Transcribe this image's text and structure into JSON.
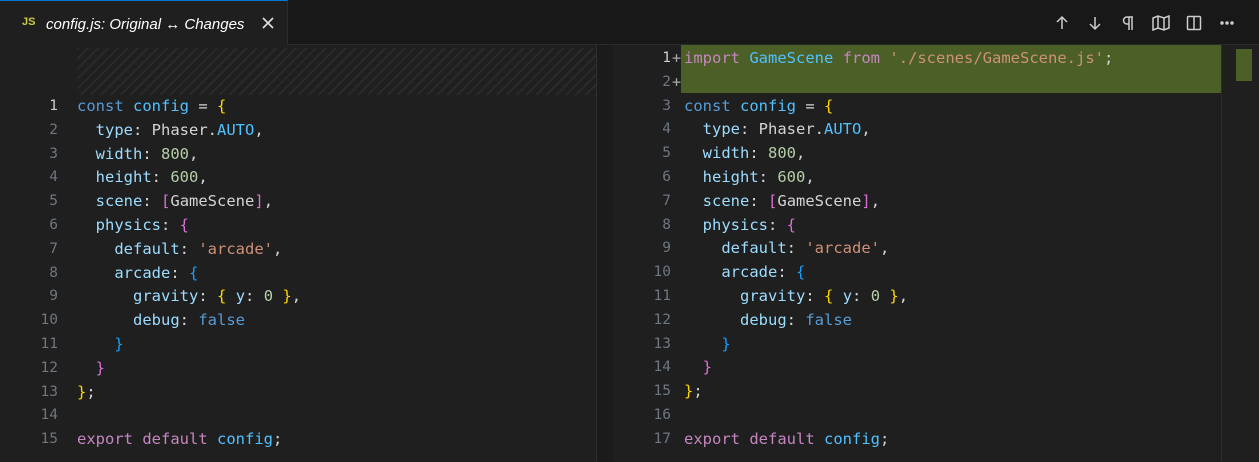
{
  "tab": {
    "icon_text": "JS",
    "title": "config.js: Original ↔ Changes"
  },
  "toolbar": {
    "actions": [
      "arrow-up-icon",
      "arrow-down-icon",
      "pilcrow-icon",
      "map-icon",
      "split-editor-icon",
      "more-icon"
    ]
  },
  "colors": {
    "accent": "#0078d4",
    "added_line": "#4b5f27",
    "keyword": "#569cd6",
    "control_keyword": "#c586c0",
    "string": "#ce9178",
    "number": "#b5cea8",
    "bracket_gold": "#ffd700",
    "bracket_pink": "#da70d6",
    "bracket_blue": "#179fff"
  },
  "left": {
    "line_numbers": [
      "1",
      "2",
      "3",
      "4",
      "5",
      "6",
      "7",
      "8",
      "9",
      "10",
      "11",
      "12",
      "13",
      "14",
      "15"
    ],
    "lines": [
      [
        [
          "kw",
          "const"
        ],
        [
          "plain",
          " "
        ],
        [
          "var",
          "config"
        ],
        [
          "plain",
          " = "
        ],
        [
          "b1",
          "{"
        ]
      ],
      [
        [
          "plain",
          "  "
        ],
        [
          "prop",
          "type"
        ],
        [
          "plain",
          ": Phaser."
        ],
        [
          "const",
          "AUTO"
        ],
        [
          "plain",
          ","
        ]
      ],
      [
        [
          "plain",
          "  "
        ],
        [
          "prop",
          "width"
        ],
        [
          "plain",
          ": "
        ],
        [
          "num",
          "800"
        ],
        [
          "plain",
          ","
        ]
      ],
      [
        [
          "plain",
          "  "
        ],
        [
          "prop",
          "height"
        ],
        [
          "plain",
          ": "
        ],
        [
          "num",
          "600"
        ],
        [
          "plain",
          ","
        ]
      ],
      [
        [
          "plain",
          "  "
        ],
        [
          "prop",
          "scene"
        ],
        [
          "plain",
          ": "
        ],
        [
          "b2",
          "["
        ],
        [
          "plain",
          "GameScene"
        ],
        [
          "b2",
          "]"
        ],
        [
          "plain",
          ","
        ]
      ],
      [
        [
          "plain",
          "  "
        ],
        [
          "prop",
          "physics"
        ],
        [
          "plain",
          ": "
        ],
        [
          "b2",
          "{"
        ]
      ],
      [
        [
          "plain",
          "    "
        ],
        [
          "prop",
          "default"
        ],
        [
          "plain",
          ": "
        ],
        [
          "str",
          "'arcade'"
        ],
        [
          "plain",
          ","
        ]
      ],
      [
        [
          "plain",
          "    "
        ],
        [
          "prop",
          "arcade"
        ],
        [
          "plain",
          ": "
        ],
        [
          "b3",
          "{"
        ]
      ],
      [
        [
          "plain",
          "      "
        ],
        [
          "prop",
          "gravity"
        ],
        [
          "plain",
          ": "
        ],
        [
          "b1",
          "{"
        ],
        [
          "plain",
          " "
        ],
        [
          "prop",
          "y"
        ],
        [
          "plain",
          ": "
        ],
        [
          "num",
          "0"
        ],
        [
          "plain",
          " "
        ],
        [
          "b1",
          "}"
        ],
        [
          "plain",
          ","
        ]
      ],
      [
        [
          "plain",
          "      "
        ],
        [
          "prop",
          "debug"
        ],
        [
          "plain",
          ": "
        ],
        [
          "kw",
          "false"
        ]
      ],
      [
        [
          "plain",
          "    "
        ],
        [
          "b3",
          "}"
        ]
      ],
      [
        [
          "plain",
          "  "
        ],
        [
          "b2",
          "}"
        ]
      ],
      [
        [
          "b1",
          "}"
        ],
        [
          "plain",
          ";"
        ]
      ],
      [],
      [
        [
          "kw2",
          "export"
        ],
        [
          "plain",
          " "
        ],
        [
          "kw2",
          "default"
        ],
        [
          "plain",
          " "
        ],
        [
          "var",
          "config"
        ],
        [
          "plain",
          ";"
        ]
      ]
    ]
  },
  "right": {
    "line_numbers": [
      "1",
      "2",
      "3",
      "4",
      "5",
      "6",
      "7",
      "8",
      "9",
      "10",
      "11",
      "12",
      "13",
      "14",
      "15",
      "16",
      "17"
    ],
    "added_markers": [
      "+",
      "+"
    ],
    "lines": [
      [
        [
          "kw2",
          "import"
        ],
        [
          "plain",
          " "
        ],
        [
          "var",
          "GameScene"
        ],
        [
          "plain",
          " "
        ],
        [
          "kw2",
          "from"
        ],
        [
          "plain",
          " "
        ],
        [
          "str",
          "'./scenes/GameScene.js'"
        ],
        [
          "plain",
          ";"
        ]
      ],
      [],
      [
        [
          "kw",
          "const"
        ],
        [
          "plain",
          " "
        ],
        [
          "var",
          "config"
        ],
        [
          "plain",
          " = "
        ],
        [
          "b1",
          "{"
        ]
      ],
      [
        [
          "plain",
          "  "
        ],
        [
          "prop",
          "type"
        ],
        [
          "plain",
          ": Phaser."
        ],
        [
          "const",
          "AUTO"
        ],
        [
          "plain",
          ","
        ]
      ],
      [
        [
          "plain",
          "  "
        ],
        [
          "prop",
          "width"
        ],
        [
          "plain",
          ": "
        ],
        [
          "num",
          "800"
        ],
        [
          "plain",
          ","
        ]
      ],
      [
        [
          "plain",
          "  "
        ],
        [
          "prop",
          "height"
        ],
        [
          "plain",
          ": "
        ],
        [
          "num",
          "600"
        ],
        [
          "plain",
          ","
        ]
      ],
      [
        [
          "plain",
          "  "
        ],
        [
          "prop",
          "scene"
        ],
        [
          "plain",
          ": "
        ],
        [
          "b2",
          "["
        ],
        [
          "plain",
          "GameScene"
        ],
        [
          "b2",
          "]"
        ],
        [
          "plain",
          ","
        ]
      ],
      [
        [
          "plain",
          "  "
        ],
        [
          "prop",
          "physics"
        ],
        [
          "plain",
          ": "
        ],
        [
          "b2",
          "{"
        ]
      ],
      [
        [
          "plain",
          "    "
        ],
        [
          "prop",
          "default"
        ],
        [
          "plain",
          ": "
        ],
        [
          "str",
          "'arcade'"
        ],
        [
          "plain",
          ","
        ]
      ],
      [
        [
          "plain",
          "    "
        ],
        [
          "prop",
          "arcade"
        ],
        [
          "plain",
          ": "
        ],
        [
          "b3",
          "{"
        ]
      ],
      [
        [
          "plain",
          "      "
        ],
        [
          "prop",
          "gravity"
        ],
        [
          "plain",
          ": "
        ],
        [
          "b1",
          "{"
        ],
        [
          "plain",
          " "
        ],
        [
          "prop",
          "y"
        ],
        [
          "plain",
          ": "
        ],
        [
          "num",
          "0"
        ],
        [
          "plain",
          " "
        ],
        [
          "b1",
          "}"
        ],
        [
          "plain",
          ","
        ]
      ],
      [
        [
          "plain",
          "      "
        ],
        [
          "prop",
          "debug"
        ],
        [
          "plain",
          ": "
        ],
        [
          "kw",
          "false"
        ]
      ],
      [
        [
          "plain",
          "    "
        ],
        [
          "b3",
          "}"
        ]
      ],
      [
        [
          "plain",
          "  "
        ],
        [
          "b2",
          "}"
        ]
      ],
      [
        [
          "b1",
          "}"
        ],
        [
          "plain",
          ";"
        ]
      ],
      [],
      [
        [
          "kw2",
          "export"
        ],
        [
          "plain",
          " "
        ],
        [
          "kw2",
          "default"
        ],
        [
          "plain",
          " "
        ],
        [
          "var",
          "config"
        ],
        [
          "plain",
          ";"
        ]
      ]
    ]
  }
}
